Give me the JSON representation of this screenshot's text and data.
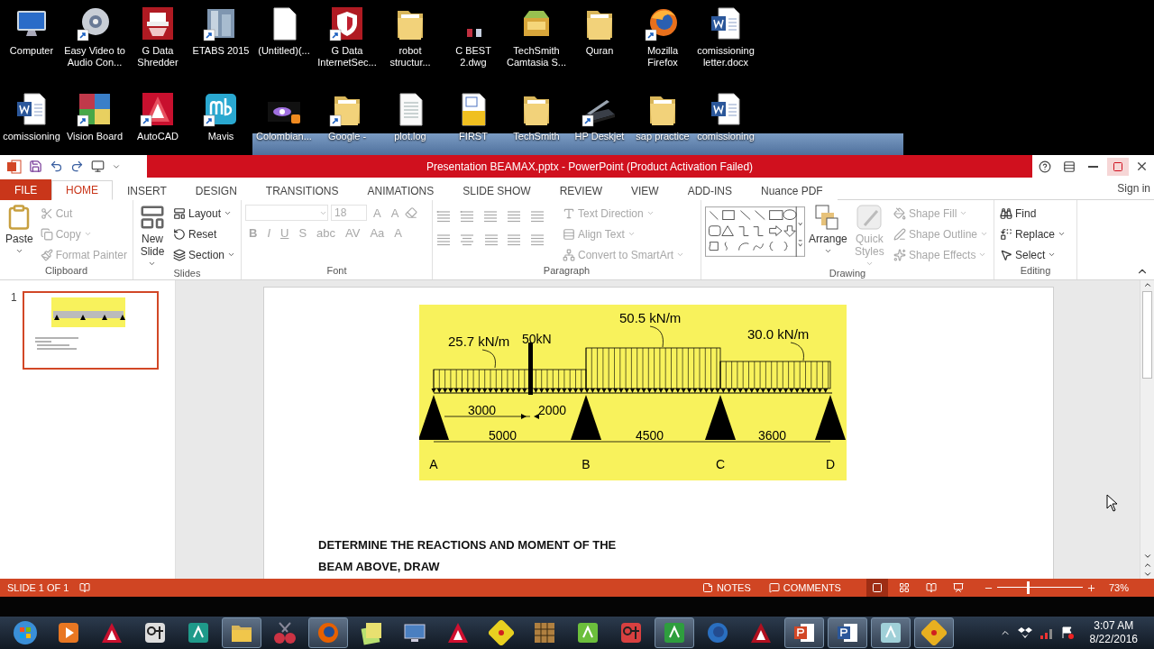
{
  "desktop": {
    "rows": [
      [
        {
          "label": "Computer",
          "kind": "computer",
          "shortcut": false
        },
        {
          "label": "Easy Video to Audio Con...",
          "kind": "disc",
          "shortcut": true
        },
        {
          "label": "G Data Shredder",
          "kind": "shredder",
          "shortcut": false
        },
        {
          "label": "ETABS 2015",
          "kind": "building",
          "shortcut": true
        },
        {
          "label": "(Untitled)(...",
          "kind": "blank",
          "shortcut": false
        },
        {
          "label": "G Data InternetSec...",
          "kind": "shield",
          "shortcut": true
        },
        {
          "label": "robot structur...",
          "kind": "folder",
          "shortcut": false
        },
        {
          "label": "C BEST 2.dwg",
          "kind": "dwgsmall",
          "shortcut": false
        },
        {
          "label": "TechSmith Camtasia S...",
          "kind": "zip",
          "shortcut": false
        },
        {
          "label": "Quran",
          "kind": "folder",
          "shortcut": false
        },
        {
          "label": "Mozilla Firefox",
          "kind": "firefox",
          "shortcut": true
        },
        {
          "label": "comissioning letter.docx",
          "kind": "word",
          "shortcut": false
        }
      ],
      [
        {
          "label": "comissioning",
          "kind": "word",
          "shortcut": false
        },
        {
          "label": "Vision Board",
          "kind": "board",
          "shortcut": true
        },
        {
          "label": "AutoCAD",
          "kind": "autocad",
          "shortcut": true
        },
        {
          "label": "Mavis",
          "kind": "mavis",
          "shortcut": true
        },
        {
          "label": "Colombian...",
          "kind": "video",
          "shortcut": false
        },
        {
          "label": "Google -",
          "kind": "folder",
          "shortcut": true
        },
        {
          "label": "plot.log",
          "kind": "text",
          "shortcut": false
        },
        {
          "label": "FIRST",
          "kind": "dwg",
          "shortcut": false
        },
        {
          "label": "TechSmith",
          "kind": "folder",
          "shortcut": false
        },
        {
          "label": "HP Deskjet",
          "kind": "scanner",
          "shortcut": true
        },
        {
          "label": "sap practice",
          "kind": "folder",
          "shortcut": false
        },
        {
          "label": "comissioning",
          "kind": "word",
          "shortcut": false
        }
      ]
    ]
  },
  "window": {
    "title": "Presentation BEAMAX.pptx -  PowerPoint (Product Activation Failed)",
    "sign_in": "Sign in"
  },
  "tabs": [
    {
      "label": "FILE",
      "kind": "file",
      "selected": false
    },
    {
      "label": "HOME",
      "kind": "tab",
      "selected": true
    },
    {
      "label": "INSERT",
      "kind": "tab",
      "selected": false
    },
    {
      "label": "DESIGN",
      "kind": "tab",
      "selected": false
    },
    {
      "label": "TRANSITIONS",
      "kind": "tab",
      "selected": false
    },
    {
      "label": "ANIMATIONS",
      "kind": "tab",
      "selected": false
    },
    {
      "label": "SLIDE SHOW",
      "kind": "tab",
      "selected": false
    },
    {
      "label": "REVIEW",
      "kind": "tab",
      "selected": false
    },
    {
      "label": "VIEW",
      "kind": "tab",
      "selected": false
    },
    {
      "label": "ADD-INS",
      "kind": "tab",
      "selected": false
    },
    {
      "label": "Nuance PDF",
      "kind": "tab",
      "selected": false
    }
  ],
  "ribbon": {
    "clipboard": {
      "name": "Clipboard",
      "paste": {
        "label": "Paste",
        "disabled": false,
        "dropdown": true
      },
      "items": [
        {
          "label": "Cut",
          "disabled": true,
          "dropdown": false
        },
        {
          "label": "Copy",
          "disabled": true,
          "dropdown": true
        },
        {
          "label": "Format Painter",
          "disabled": true,
          "dropdown": false
        }
      ]
    },
    "slides": {
      "name": "Slides",
      "new_slide": {
        "label": "New Slide",
        "disabled": false,
        "dropdown": true
      },
      "items": [
        {
          "label": "Layout",
          "disabled": false,
          "dropdown": true
        },
        {
          "label": "Reset",
          "disabled": false,
          "dropdown": false
        },
        {
          "label": "Section",
          "disabled": false,
          "dropdown": true
        }
      ]
    },
    "font": {
      "name": "Font",
      "disabled": true,
      "font_size": "18",
      "size_buttons": [
        "A",
        "A"
      ],
      "format_buttons": [
        "B",
        "I",
        "U",
        "S",
        "abc",
        "AV",
        "Aa",
        "A"
      ]
    },
    "paragraph": {
      "name": "Paragraph",
      "disabled": true,
      "items": [
        {
          "label": "Text Direction",
          "disabled": true,
          "dropdown": true
        },
        {
          "label": "Align Text",
          "disabled": true,
          "dropdown": true
        },
        {
          "label": "Convert to SmartArt",
          "disabled": true,
          "dropdown": true
        }
      ]
    },
    "drawing": {
      "name": "Drawing",
      "arrange": {
        "label": "Arrange",
        "disabled": false,
        "dropdown": true
      },
      "quick_styles": {
        "label": "Quick Styles",
        "disabled": true,
        "dropdown": true
      },
      "items": [
        {
          "label": "Shape Fill",
          "disabled": true,
          "dropdown": true
        },
        {
          "label": "Shape Outline",
          "disabled": true,
          "dropdown": true
        },
        {
          "label": "Shape Effects",
          "disabled": true,
          "dropdown": true
        }
      ]
    },
    "editing": {
      "name": "Editing",
      "items": [
        {
          "label": "Find",
          "disabled": false,
          "dropdown": false
        },
        {
          "label": "Replace",
          "disabled": false,
          "dropdown": true
        },
        {
          "label": "Select",
          "disabled": false,
          "dropdown": true
        }
      ]
    }
  },
  "thumbnails": [
    {
      "number": "1",
      "selected": true
    }
  ],
  "slide": {
    "beam": {
      "loads": [
        "25.7 kN/m",
        "50.5 kN/m",
        "30.0 kN/m"
      ],
      "point_load": "50kN",
      "spans": [
        "3000",
        "2000",
        "5000",
        "4500",
        "3600"
      ],
      "supports": [
        "A",
        "B",
        "C",
        "D"
      ]
    },
    "text": "DETERMINE THE REACTIONS AND MOMENT OF THE BEAM ABOVE, DRAW"
  },
  "status_bar": {
    "slide_indicator": "SLIDE 1 OF 1",
    "notes": "NOTES",
    "comments": "COMMENTS",
    "views": [
      {
        "selected": true
      },
      {
        "selected": false
      },
      {
        "selected": false
      },
      {
        "selected": false
      }
    ],
    "zoom": {
      "level": 0.35,
      "reading": "73%"
    }
  },
  "taskbar": {
    "apps": [
      {
        "kind": "orb",
        "color": "#3a8fd8",
        "active": false
      },
      {
        "kind": "play",
        "color": "#e87722",
        "active": false
      },
      {
        "kind": "triangle",
        "color": "#c8102e",
        "active": false
      },
      {
        "kind": "tool",
        "color": "#dddddd",
        "active": false
      },
      {
        "kind": "tile",
        "color": "#1f9a8a",
        "active": false
      },
      {
        "kind": "folder",
        "color": "#f0c64b",
        "active": true
      },
      {
        "kind": "scissors",
        "color": "#cc3344",
        "active": false
      },
      {
        "kind": "globe",
        "color": "#e66000",
        "active": true
      },
      {
        "kind": "notes",
        "color": "#e8e070",
        "active": false
      },
      {
        "kind": "monitor",
        "color": "#4a7fc0",
        "active": false
      },
      {
        "kind": "triangle",
        "color": "#d01030",
        "active": false
      },
      {
        "kind": "star",
        "color": "#e8d020",
        "active": false
      },
      {
        "kind": "grid",
        "color": "#b08040",
        "active": false
      },
      {
        "kind": "tile",
        "color": "#6cbf3c",
        "active": false
      },
      {
        "kind": "tool",
        "color": "#d84040",
        "active": false
      },
      {
        "kind": "tile",
        "color": "#2e9e3e",
        "active": true
      },
      {
        "kind": "globe",
        "color": "#2a6fc0",
        "active": false
      },
      {
        "kind": "triangle",
        "color": "#b01020",
        "active": false
      },
      {
        "kind": "doc",
        "color": "#d24726",
        "active": true
      },
      {
        "kind": "doc",
        "color": "#2b579a",
        "active": true
      },
      {
        "kind": "tile",
        "color": "#a0d0d8",
        "active": true
      },
      {
        "kind": "star",
        "color": "#e8b020",
        "active": true
      }
    ],
    "time": "3:07 AM",
    "date": "8/22/2016"
  }
}
